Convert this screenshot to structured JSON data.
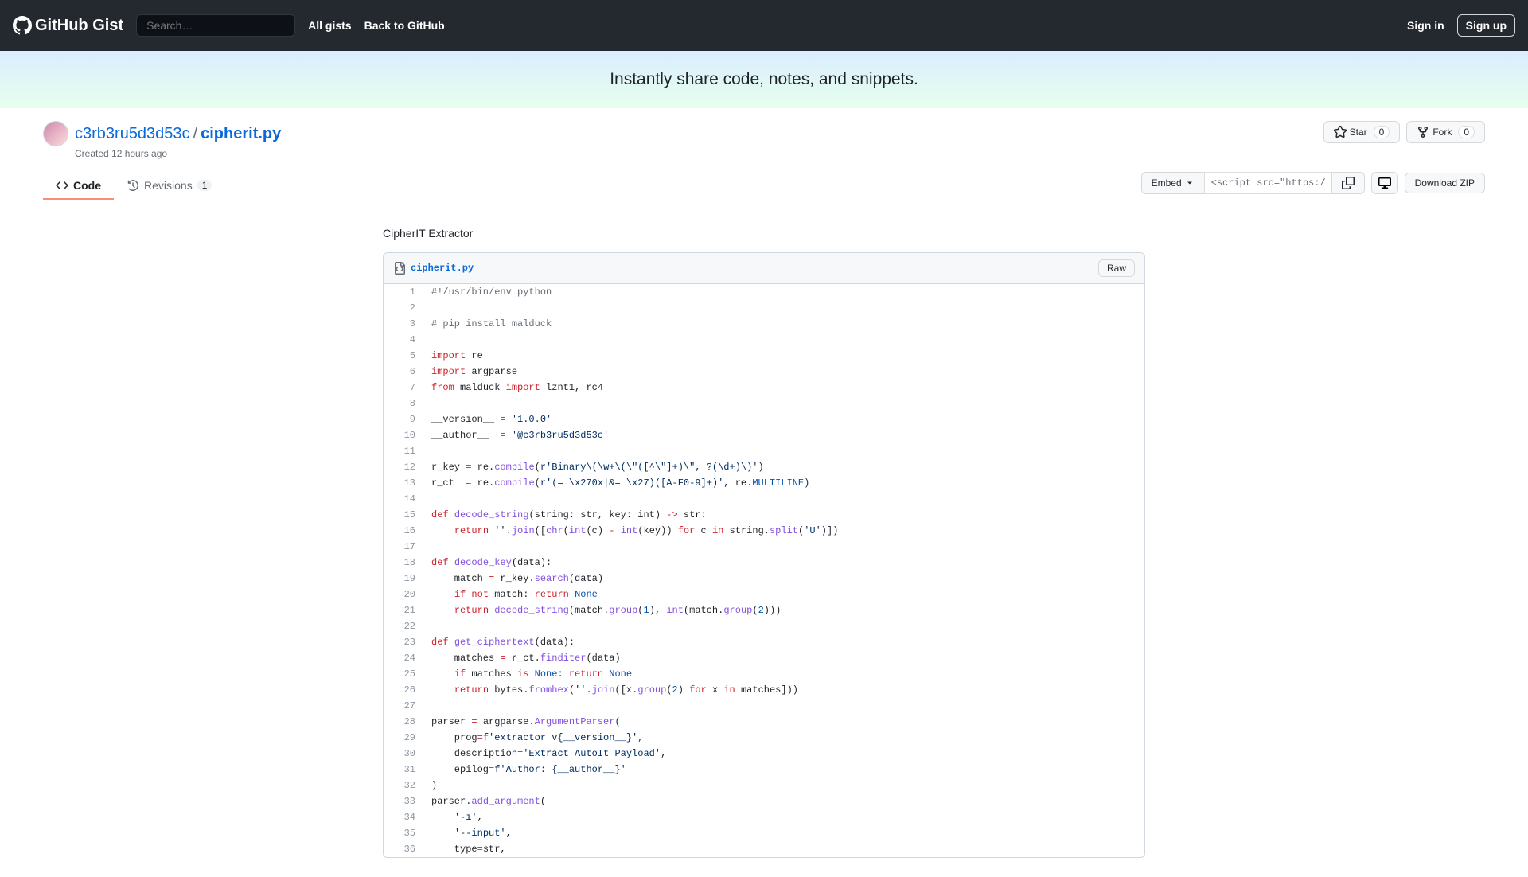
{
  "header": {
    "logo": "GitHub Gist",
    "search_placeholder": "Search…",
    "nav": {
      "all_gists": "All gists",
      "back": "Back to GitHub"
    },
    "sign_in": "Sign in",
    "sign_up": "Sign up"
  },
  "banner": "Instantly share code, notes, and snippets.",
  "gist": {
    "owner": "c3rb3ru5d3d53c",
    "filename": "cipherit.py",
    "created": "Created 12 hours ago",
    "description": "CipherIT Extractor"
  },
  "actions": {
    "star_label": "Star",
    "star_count": "0",
    "fork_label": "Fork",
    "fork_count": "0"
  },
  "tabs": {
    "code": "Code",
    "revisions": "Revisions",
    "revisions_count": "1"
  },
  "toolbar": {
    "embed": "Embed",
    "embed_url": "<script src=\"https://g",
    "download": "Download ZIP"
  },
  "file": {
    "name": "cipherit.py",
    "raw": "Raw"
  },
  "code": [
    {
      "n": 1,
      "h": "<span class='pl-c'>#!/usr/bin/env python</span>"
    },
    {
      "n": 2,
      "h": ""
    },
    {
      "n": 3,
      "h": "<span class='pl-c'># pip install malduck</span>"
    },
    {
      "n": 4,
      "h": ""
    },
    {
      "n": 5,
      "h": "<span class='pl-k'>import</span> re"
    },
    {
      "n": 6,
      "h": "<span class='pl-k'>import</span> argparse"
    },
    {
      "n": 7,
      "h": "<span class='pl-k'>from</span> malduck <span class='pl-k'>import</span> lznt1, rc4"
    },
    {
      "n": 8,
      "h": ""
    },
    {
      "n": 9,
      "h": "__version__ <span class='pl-k'>=</span> <span class='pl-s'>'1.0.0'</span>"
    },
    {
      "n": 10,
      "h": "__author__  <span class='pl-k'>=</span> <span class='pl-s'>'@c3rb3ru5d3d53c'</span>"
    },
    {
      "n": 11,
      "h": ""
    },
    {
      "n": 12,
      "h": "r_key <span class='pl-k'>=</span> re.<span class='pl-en'>compile</span>(<span class='pl-s'>r'Binary\\(\\w+\\(\\\"([^\\\"]+)\\\", ?(\\d+)\\)'</span>)"
    },
    {
      "n": 13,
      "h": "r_ct  <span class='pl-k'>=</span> re.<span class='pl-en'>compile</span>(<span class='pl-s'>r'(= \\x270x|&= \\x27)([A-F0-9]+)'</span>, re.<span class='pl-c1'>MULTILINE</span>)"
    },
    {
      "n": 14,
      "h": ""
    },
    {
      "n": 15,
      "h": "<span class='pl-k'>def</span> <span class='pl-en'>decode_string</span>(string: str, key: int) <span class='pl-k'>-&gt;</span> str:"
    },
    {
      "n": 16,
      "h": "    <span class='pl-k'>return</span> <span class='pl-s'>''</span>.<span class='pl-en'>join</span>([<span class='pl-en'>chr</span>(<span class='pl-en'>int</span>(c) <span class='pl-k'>-</span> <span class='pl-en'>int</span>(key)) <span class='pl-k'>for</span> c <span class='pl-k'>in</span> string.<span class='pl-en'>split</span>(<span class='pl-s'>'U'</span>)])"
    },
    {
      "n": 17,
      "h": ""
    },
    {
      "n": 18,
      "h": "<span class='pl-k'>def</span> <span class='pl-en'>decode_key</span>(data):"
    },
    {
      "n": 19,
      "h": "    match <span class='pl-k'>=</span> r_key.<span class='pl-en'>search</span>(data)"
    },
    {
      "n": 20,
      "h": "    <span class='pl-k'>if</span> <span class='pl-k'>not</span> match: <span class='pl-k'>return</span> <span class='pl-c1'>None</span>"
    },
    {
      "n": 21,
      "h": "    <span class='pl-k'>return</span> <span class='pl-en'>decode_string</span>(match.<span class='pl-en'>group</span>(<span class='pl-c1'>1</span>), <span class='pl-en'>int</span>(match.<span class='pl-en'>group</span>(<span class='pl-c1'>2</span>)))"
    },
    {
      "n": 22,
      "h": ""
    },
    {
      "n": 23,
      "h": "<span class='pl-k'>def</span> <span class='pl-en'>get_ciphertext</span>(data):"
    },
    {
      "n": 24,
      "h": "    matches <span class='pl-k'>=</span> r_ct.<span class='pl-en'>finditer</span>(data)"
    },
    {
      "n": 25,
      "h": "    <span class='pl-k'>if</span> matches <span class='pl-k'>is</span> <span class='pl-c1'>None</span>: <span class='pl-k'>return</span> <span class='pl-c1'>None</span>"
    },
    {
      "n": 26,
      "h": "    <span class='pl-k'>return</span> bytes.<span class='pl-en'>fromhex</span>(<span class='pl-s'>''</span>.<span class='pl-en'>join</span>([x.<span class='pl-en'>group</span>(<span class='pl-c1'>2</span>) <span class='pl-k'>for</span> x <span class='pl-k'>in</span> matches]))"
    },
    {
      "n": 27,
      "h": ""
    },
    {
      "n": 28,
      "h": "parser <span class='pl-k'>=</span> argparse.<span class='pl-en'>ArgumentParser</span>("
    },
    {
      "n": 29,
      "h": "    prog<span class='pl-k'>=</span><span class='pl-s'>f'extractor v{__version__}'</span>,"
    },
    {
      "n": 30,
      "h": "    description<span class='pl-k'>=</span><span class='pl-s'>'Extract AutoIt Payload'</span>,"
    },
    {
      "n": 31,
      "h": "    epilog<span class='pl-k'>=</span><span class='pl-s'>f'Author: {__author__}'</span>"
    },
    {
      "n": 32,
      "h": ")"
    },
    {
      "n": 33,
      "h": "parser.<span class='pl-en'>add_argument</span>("
    },
    {
      "n": 34,
      "h": "    <span class='pl-s'>'-i'</span>,"
    },
    {
      "n": 35,
      "h": "    <span class='pl-s'>'--input'</span>,"
    },
    {
      "n": 36,
      "h": "    type<span class='pl-k'>=</span>str,"
    }
  ]
}
